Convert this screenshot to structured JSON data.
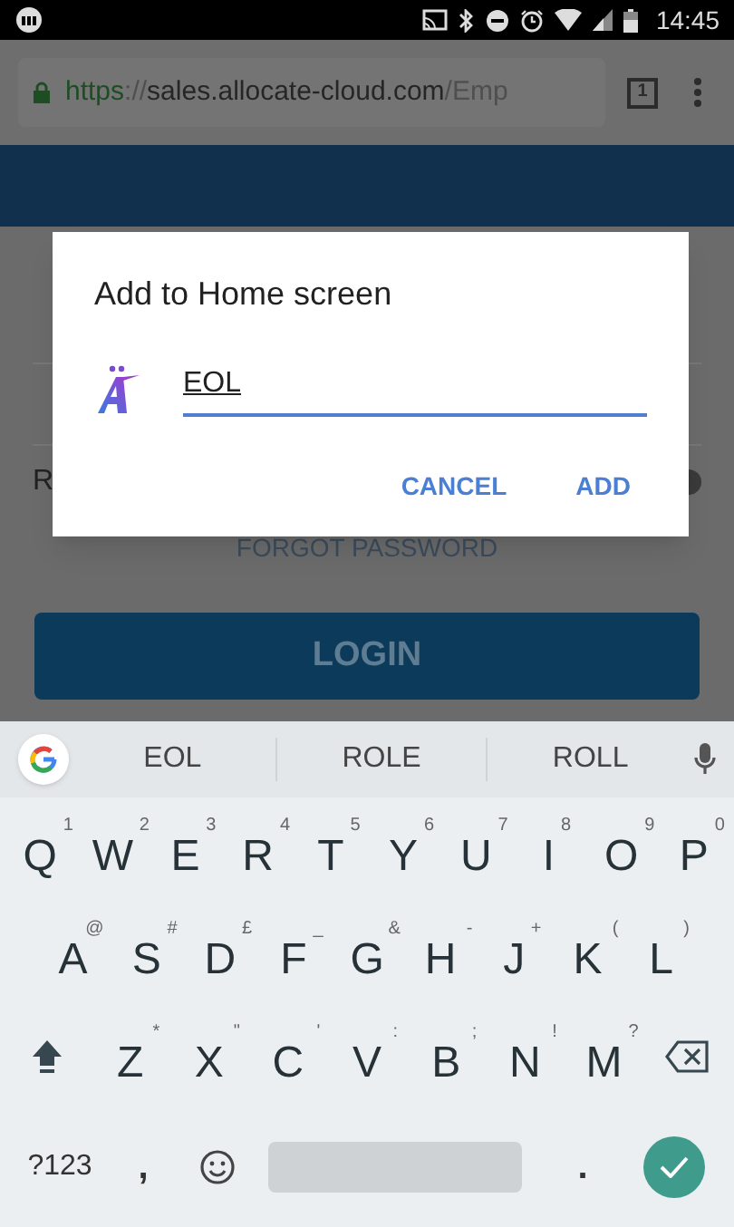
{
  "status_bar": {
    "time": "14:45"
  },
  "browser": {
    "url_scheme": "https",
    "url_separator": "://",
    "url_host": "sales.allocate-cloud.com",
    "url_path": "/Emp",
    "tab_count": "1"
  },
  "page": {
    "partial_label": "R",
    "forgot_link": "FORGOT PASSWORD",
    "login_button": "LOGIN"
  },
  "dialog": {
    "title": "Add to Home screen",
    "name_value": "EOL",
    "buttons": [
      "CANCEL",
      "ADD"
    ]
  },
  "keyboard": {
    "suggestions": [
      "EOL",
      "ROLE",
      "ROLL"
    ],
    "top_row": [
      {
        "key": "Q",
        "hint": "1"
      },
      {
        "key": "W",
        "hint": "2"
      },
      {
        "key": "E",
        "hint": "3"
      },
      {
        "key": "R",
        "hint": "4"
      },
      {
        "key": "T",
        "hint": "5"
      },
      {
        "key": "Y",
        "hint": "6"
      },
      {
        "key": "U",
        "hint": "7"
      },
      {
        "key": "I",
        "hint": "8"
      },
      {
        "key": "O",
        "hint": "9"
      },
      {
        "key": "P",
        "hint": "0"
      }
    ],
    "middle_row": [
      {
        "key": "A",
        "hint": "@"
      },
      {
        "key": "S",
        "hint": "#"
      },
      {
        "key": "D",
        "hint": "£"
      },
      {
        "key": "F",
        "hint": "_"
      },
      {
        "key": "G",
        "hint": "&"
      },
      {
        "key": "H",
        "hint": "-"
      },
      {
        "key": "J",
        "hint": "+"
      },
      {
        "key": "K",
        "hint": "("
      },
      {
        "key": "L",
        "hint": ")"
      }
    ],
    "bottom_row": [
      {
        "key": "Z",
        "hint": "*"
      },
      {
        "key": "X",
        "hint": "\""
      },
      {
        "key": "C",
        "hint": "'"
      },
      {
        "key": "V",
        "hint": ":"
      },
      {
        "key": "B",
        "hint": ";"
      },
      {
        "key": "N",
        "hint": "!"
      },
      {
        "key": "M",
        "hint": "?"
      }
    ],
    "symbols_key": "?123",
    "comma_key": ",",
    "period_key": "."
  }
}
